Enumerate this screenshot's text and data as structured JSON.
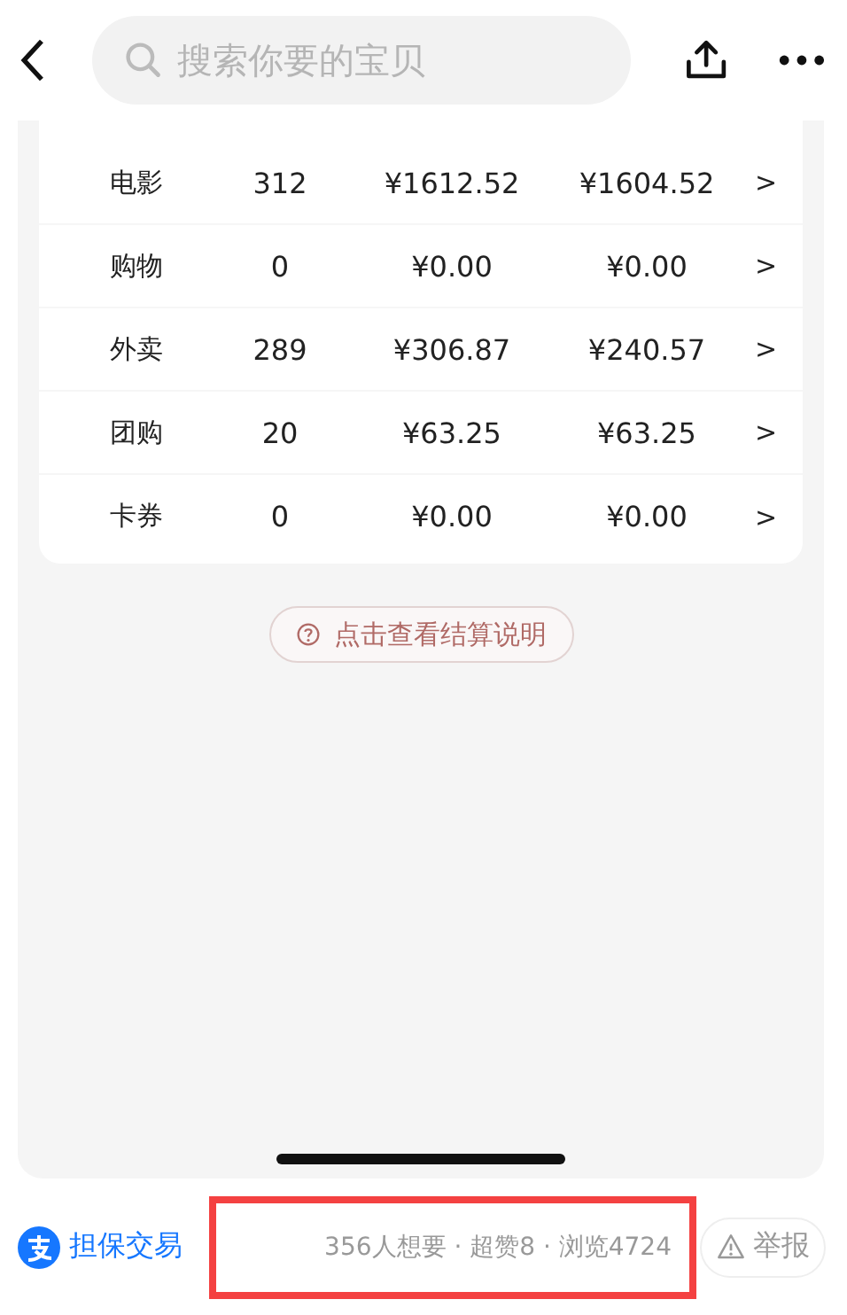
{
  "search": {
    "placeholder": "搜索你要的宝贝"
  },
  "table": {
    "rows": [
      {
        "name": "电影",
        "count": "312",
        "amount": "¥1612.52",
        "settled": "¥1604.52",
        "arrow": ">"
      },
      {
        "name": "购物",
        "count": "0",
        "amount": "¥0.00",
        "settled": "¥0.00",
        "arrow": ">"
      },
      {
        "name": "外卖",
        "count": "289",
        "amount": "¥306.87",
        "settled": "¥240.57",
        "arrow": ">"
      },
      {
        "name": "团购",
        "count": "20",
        "amount": "¥63.25",
        "settled": "¥63.25",
        "arrow": ">"
      },
      {
        "name": "卡券",
        "count": "0",
        "amount": "¥0.00",
        "settled": "¥0.00",
        "arrow": ">"
      }
    ]
  },
  "help_button": {
    "label": "点击查看结算说明"
  },
  "footer": {
    "escrow": "担保交易",
    "stats": "356人想要 · 超赞8 · 浏览4724",
    "report": "举报",
    "highlighted": true
  }
}
